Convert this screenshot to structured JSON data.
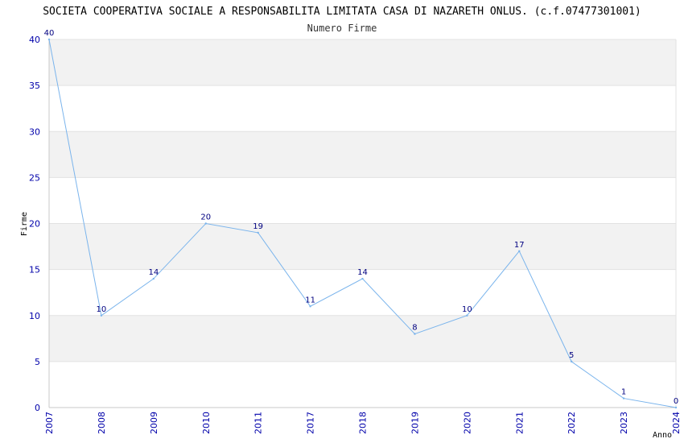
{
  "chart_data": {
    "type": "line",
    "title": "SOCIETA COOPERATIVA SOCIALE A RESPONSABILITA LIMITATA CASA DI NAZARETH ONLUS. (c.f.07477301001)",
    "subtitle": "Numero Firme",
    "xlabel": "Anno",
    "ylabel": "Firme",
    "categories": [
      "2007",
      "2008",
      "2009",
      "2010",
      "2011",
      "2017",
      "2018",
      "2019",
      "2020",
      "2021",
      "2022",
      "2023",
      "2024"
    ],
    "series": [
      {
        "values": [
          40,
          10,
          14,
          20,
          19,
          11,
          14,
          8,
          10,
          17,
          5,
          1,
          0
        ]
      }
    ],
    "ylim": [
      0,
      40
    ],
    "yticks": [
      0,
      5,
      10,
      15,
      20,
      25,
      30,
      35,
      40
    ],
    "grid": true,
    "colors": {
      "line": "#7ab4ec",
      "band": "#f2f2f2",
      "tick_text": "#0000aa",
      "data_label": "#000080"
    }
  }
}
